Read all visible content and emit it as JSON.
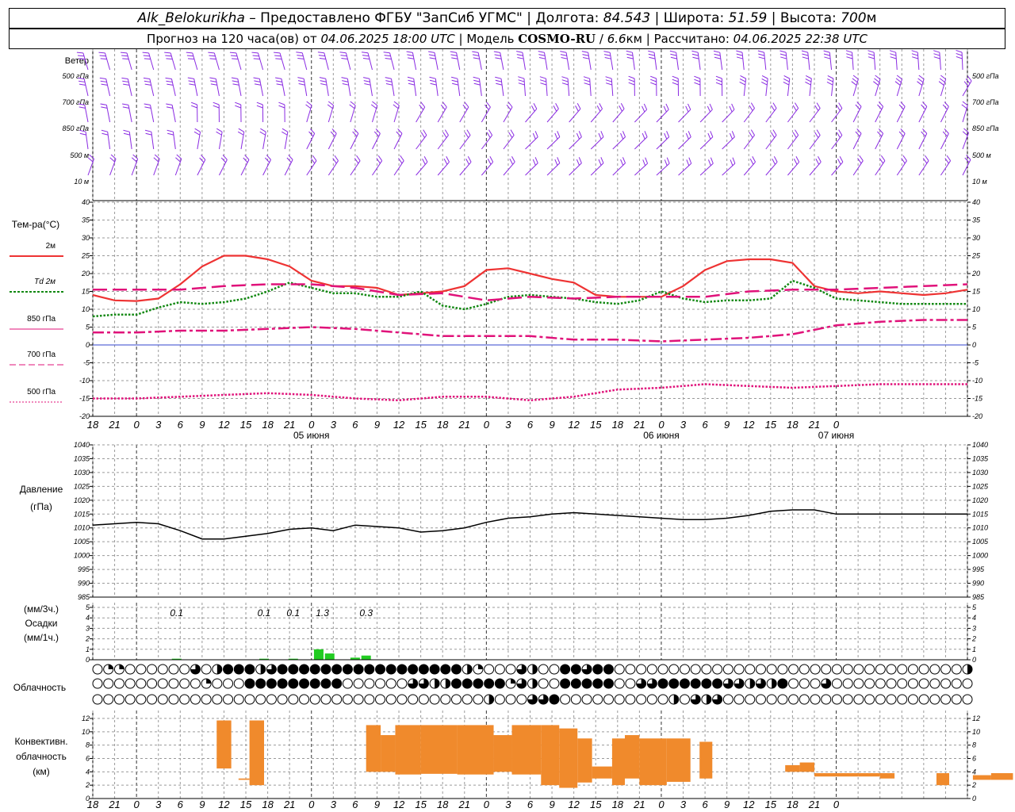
{
  "header": {
    "station": "Alk_Belokurikha",
    "dash": " – ",
    "provider": "Предоставлено ФГБУ \"ЗапСиб УГМС\"",
    "lon_label": "Долгота:",
    "lon": "84.543",
    "lat_label": "Широта:",
    "lat": "51.59",
    "alt_label": "Высота:",
    "alt": "700",
    "alt_unit": "м",
    "sep": " | ",
    "forecast_label": "Прогноз на 120 часа(ов) от",
    "forecast_time": "04.06.2025 18:00 UTC",
    "model_label": "Модель",
    "model": "COSMO-RU",
    "slash": " / ",
    "resolution": "6.6",
    "res_unit": "км",
    "computed_label": "Рассчитано:",
    "computed": "04.06.2025 22:38 UTC"
  },
  "wind": {
    "title": "Ветер",
    "levels": [
      "500 гПа",
      "700 гПа",
      "850 гПа",
      "500 м",
      "10  м"
    ],
    "color": "#8a2be2"
  },
  "temperature": {
    "title": "Тем-ра(°С)",
    "legend": [
      {
        "label": "2м",
        "color": "#ee3333"
      },
      {
        "label": "Td  2м",
        "color": "#118811"
      },
      {
        "label": "850 гПа",
        "color": "#e0127a"
      },
      {
        "label": "700 гПа",
        "color": "#e0127a"
      },
      {
        "label": "500 гПа",
        "color": "#e0127a"
      }
    ],
    "yticks": [
      "40",
      "35",
      "30",
      "25",
      "20",
      "15",
      "10",
      "5",
      "0",
      "-5",
      "-10",
      "-15",
      "-20"
    ],
    "xticks": [
      "18",
      "21",
      "0",
      "3",
      "6",
      "9",
      "12",
      "15",
      "18",
      "21",
      "0",
      "3",
      "6",
      "9",
      "12",
      "15",
      "18",
      "21",
      "0",
      "3",
      "6",
      "9",
      "12",
      "15",
      "18",
      "21",
      "0",
      "3",
      "6",
      "9",
      "12",
      "15",
      "18",
      "21",
      "0"
    ],
    "dates": [
      "05 июня",
      "06 июня",
      "07 июня"
    ]
  },
  "pressure": {
    "title": "Давление",
    "unit": "(гПа)",
    "yticks": [
      "1040",
      "1035",
      "1030",
      "1025",
      "1020",
      "1015",
      "1010",
      "1005",
      "1000",
      "995",
      "990",
      "985"
    ]
  },
  "precip": {
    "unit3": "(мм/3ч.)",
    "title": "Осадки",
    "unit1": "(мм/1ч.)",
    "yticks": [
      "5",
      "4",
      "3",
      "2",
      "1",
      "0"
    ],
    "labels": [
      "0.1",
      "0.1",
      "0.1",
      "1.3",
      "0.3"
    ],
    "color": "#22cc22"
  },
  "cloud": {
    "title": "Облачность"
  },
  "convective": {
    "title1": "Конвективн.",
    "title2": "облачность",
    "unit": "(км)",
    "yticks": [
      "12",
      "10",
      "8",
      "6",
      "4",
      "2",
      "0"
    ],
    "color": "#f08a2c"
  },
  "bottom_xticks": [
    "18",
    "21",
    "0",
    "3",
    "6",
    "9",
    "12",
    "15",
    "18",
    "21",
    "0",
    "3",
    "6",
    "9",
    "12",
    "15",
    "18",
    "21",
    "0",
    "3",
    "6",
    "9",
    "12",
    "15",
    "18",
    "21",
    "0",
    "3",
    "6",
    "9",
    "12",
    "15",
    "18",
    "21",
    "0"
  ],
  "chart_data": {
    "type": "line",
    "x_unit": "hours since 04.06.2025 18:00 UTC",
    "temperature_series": [
      {
        "name": "2м",
        "x": [
          0,
          3,
          6,
          9,
          12,
          15,
          18,
          21,
          24,
          27,
          30,
          33,
          36,
          39,
          42,
          45,
          48,
          51,
          54,
          57,
          60,
          63,
          66,
          69,
          72,
          75,
          78,
          81,
          84,
          87,
          90,
          93,
          96,
          99,
          102,
          105,
          108,
          111,
          114,
          117,
          120
        ],
        "values": [
          14,
          12.5,
          12.3,
          13,
          17,
          22,
          25,
          25,
          24,
          22,
          18,
          16.5,
          16.5,
          16,
          14,
          14.5,
          15,
          16.5,
          21,
          21.5,
          20,
          18.5,
          17.5,
          14,
          13.5,
          13.5,
          13.5,
          16.5,
          21,
          23.5,
          24,
          24,
          23,
          16.5,
          15,
          14.5,
          15,
          14.5,
          14,
          14.5,
          15.5
        ]
      },
      {
        "name": "Td  2м",
        "x": [
          0,
          3,
          6,
          9,
          12,
          15,
          18,
          21,
          24,
          27,
          30,
          33,
          36,
          39,
          42,
          45,
          48,
          51,
          54,
          57,
          60,
          63,
          66,
          69,
          72,
          75,
          78,
          81,
          84,
          87,
          90,
          93,
          96,
          99,
          102,
          105,
          108,
          111,
          114,
          117,
          120
        ],
        "values": [
          8,
          8.5,
          8.5,
          10.5,
          12,
          11.5,
          12,
          13,
          15,
          17.5,
          16,
          14.5,
          14.5,
          13.5,
          13.5,
          15,
          11,
          10,
          11.5,
          13.5,
          14,
          13.5,
          13,
          12,
          11.5,
          12.5,
          15,
          13,
          12,
          12.5,
          12.5,
          13,
          18,
          16,
          13,
          12.5,
          12,
          11.5,
          11.5,
          11.5,
          11.5
        ]
      },
      {
        "name": "850 гПа",
        "x": [
          0,
          6,
          12,
          18,
          24,
          30,
          36,
          42,
          48,
          54,
          60,
          66,
          72,
          78,
          84,
          90,
          96,
          102,
          108,
          114,
          120
        ],
        "values": [
          15.5,
          15.5,
          15.5,
          16.5,
          17,
          17,
          16,
          14,
          14.5,
          12.5,
          13.5,
          13,
          13.5,
          13.5,
          13.5,
          15,
          15.5,
          15.5,
          16,
          16.5,
          17
        ]
      },
      {
        "name": "700 гПа",
        "x": [
          0,
          6,
          12,
          18,
          24,
          30,
          36,
          42,
          48,
          54,
          60,
          66,
          72,
          78,
          84,
          90,
          96,
          102,
          108,
          114,
          120
        ],
        "values": [
          3.5,
          3.5,
          4,
          4,
          4.5,
          5,
          4.5,
          3.5,
          2.5,
          2.5,
          2.5,
          1.5,
          1.5,
          1,
          1.5,
          2,
          3,
          5.5,
          6.5,
          7,
          7
        ]
      },
      {
        "name": "500 гПа",
        "x": [
          0,
          6,
          12,
          18,
          24,
          30,
          36,
          42,
          48,
          54,
          60,
          66,
          72,
          78,
          84,
          90,
          96,
          102,
          108,
          114,
          120
        ],
        "values": [
          -15,
          -15,
          -14.5,
          -14,
          -13.5,
          -14,
          -15,
          -15.5,
          -14.5,
          -14.5,
          -15.5,
          -14.5,
          -12.5,
          -12,
          -11,
          -11.5,
          -12,
          -11.5,
          -11,
          -11,
          -11
        ]
      }
    ],
    "temperature_ylim": [
      -20,
      40
    ],
    "pressure": {
      "x": [
        0,
        3,
        6,
        9,
        12,
        15,
        18,
        21,
        24,
        27,
        30,
        33,
        36,
        39,
        42,
        45,
        48,
        51,
        54,
        57,
        60,
        63,
        66,
        69,
        72,
        75,
        78,
        81,
        84,
        87,
        90,
        93,
        96,
        99,
        102,
        105,
        108,
        111,
        114,
        117,
        120
      ],
      "values": [
        1011,
        1011.5,
        1012,
        1011.5,
        1009,
        1006,
        1006,
        1007,
        1008,
        1009.5,
        1010,
        1009,
        1011,
        1010.5,
        1010,
        1008.5,
        1009,
        1010,
        1012,
        1013.5,
        1014,
        1015,
        1015.5,
        1015,
        1014.5,
        1014,
        1013.5,
        1013,
        1013,
        1013.5,
        1014.5,
        1016,
        1016.5,
        1016.5,
        1015,
        1015,
        1015,
        1015,
        1015,
        1015,
        1015
      ],
      "ylim": [
        985,
        1040
      ]
    },
    "precip_1h": {
      "x": [
        11.5,
        23.5,
        27.5,
        31,
        32.5,
        36,
        37.5
      ],
      "values": [
        0.1,
        0.1,
        0.1,
        1.0,
        0.6,
        0.2,
        0.4
      ],
      "ylim": [
        0,
        5
      ]
    },
    "convective_cloud_km": {
      "bars": [
        [
          6.8,
          7.6,
          4.5,
          11.7
        ],
        [
          8.0,
          8.6,
          2.8,
          3.0
        ],
        [
          8.6,
          9.4,
          2.0,
          11.7
        ],
        [
          15.0,
          15.8,
          4.0,
          11.0
        ],
        [
          15.8,
          16.6,
          4.0,
          9.5
        ],
        [
          16.6,
          18.0,
          3.6,
          11.0
        ],
        [
          18.0,
          20.0,
          3.7,
          11.0
        ],
        [
          20.0,
          22.0,
          3.6,
          11.0
        ],
        [
          22.0,
          23.0,
          4.0,
          9.5
        ],
        [
          23.0,
          24.6,
          3.6,
          11.0
        ],
        [
          24.6,
          25.6,
          2.0,
          11.0
        ],
        [
          25.6,
          26.6,
          1.6,
          10.5
        ],
        [
          26.6,
          27.4,
          2.4,
          9.0
        ],
        [
          27.4,
          28.5,
          3.0,
          4.8
        ],
        [
          28.5,
          29.2,
          2.0,
          9.0
        ],
        [
          29.2,
          30.0,
          3.0,
          9.5
        ],
        [
          30.0,
          31.5,
          2.0,
          9.0
        ],
        [
          31.5,
          32.8,
          2.5,
          9.0
        ],
        [
          33.3,
          34.0,
          3.0,
          8.5
        ],
        [
          38.0,
          38.8,
          4.0,
          5.0
        ],
        [
          38.8,
          39.6,
          4.0,
          5.4
        ],
        [
          39.6,
          42.0,
          3.3,
          3.8
        ],
        [
          42.0,
          43.2,
          3.3,
          3.8
        ],
        [
          43.2,
          44.0,
          3.0,
          3.8
        ],
        [
          46.3,
          47.0,
          2.0,
          3.8
        ],
        [
          48.3,
          49.3,
          2.8,
          3.5
        ],
        [
          49.3,
          50.5,
          2.8,
          3.8
        ]
      ],
      "ylim": [
        0,
        13
      ]
    },
    "cloud_cover_rows": 3
  }
}
